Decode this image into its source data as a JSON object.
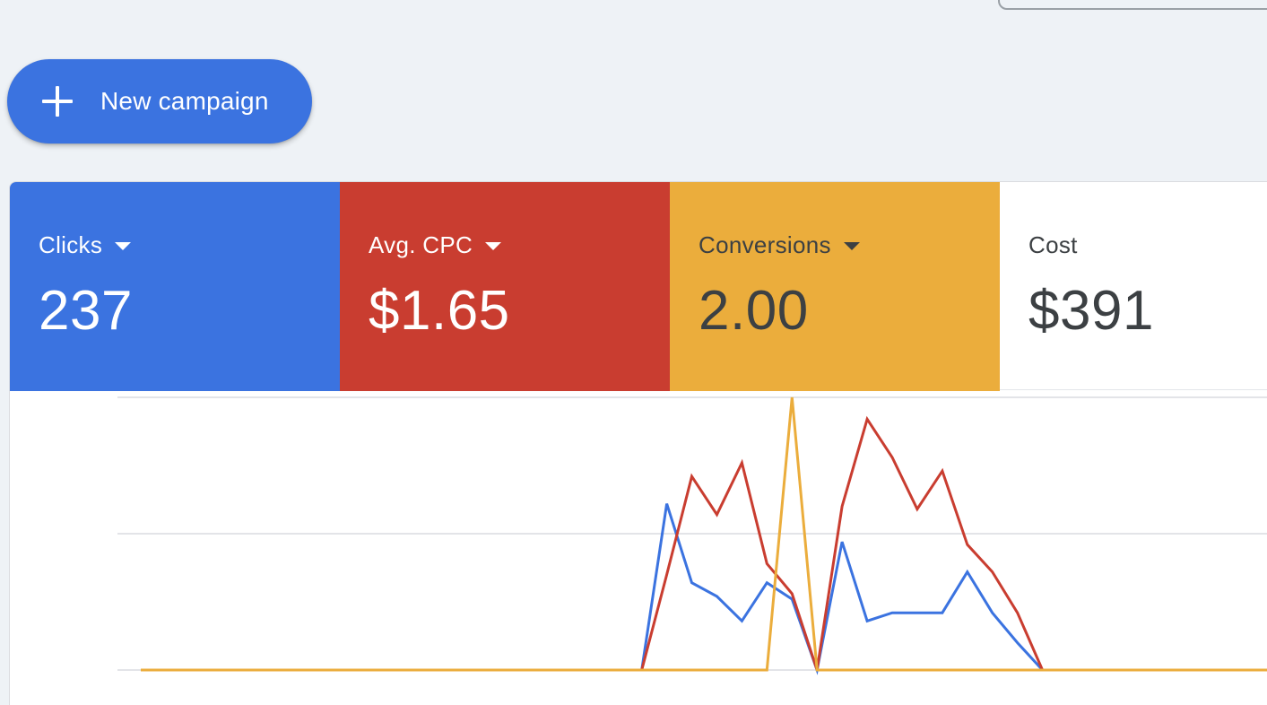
{
  "toolbar": {
    "new_campaign_label": "New campaign"
  },
  "scorecards": [
    {
      "label": "Clicks",
      "value": "237",
      "dropdown": true,
      "color": "#3b73e0"
    },
    {
      "label": "Avg. CPC",
      "value": "$1.65",
      "dropdown": true,
      "color": "#c93d30"
    },
    {
      "label": "Conversions",
      "value": "2.00",
      "dropdown": true,
      "color": "#ebad3c"
    },
    {
      "label": "Cost",
      "value": "$391",
      "dropdown": false,
      "color": "#ffffff"
    }
  ],
  "icons": {
    "new_campaign": "plus-icon",
    "dropdown": "caret-down-icon"
  },
  "chart_data": {
    "type": "line",
    "grid": true,
    "ylim": [
      0,
      1
    ],
    "x": [
      0,
      1,
      2,
      3,
      4,
      5,
      6,
      7,
      8,
      9,
      10,
      11,
      12,
      13,
      14,
      15,
      16,
      17,
      18,
      19,
      20,
      21,
      22,
      23,
      24,
      25,
      26,
      27,
      28,
      29,
      30,
      31,
      32,
      33,
      34,
      35,
      36,
      37,
      38,
      39,
      40,
      41,
      42,
      43,
      44,
      45
    ],
    "series": [
      {
        "color": "#3b73e0",
        "values": [
          0,
          0,
          0,
          0,
          0,
          0,
          0,
          0,
          0,
          0,
          0,
          0,
          0,
          0,
          0,
          0,
          0,
          0,
          0,
          0,
          0,
          0.61,
          0.32,
          0.27,
          0.18,
          0.32,
          0.26,
          0,
          0.47,
          0.18,
          0.21,
          0.21,
          0.21,
          0.36,
          0.21,
          0.1,
          0,
          0,
          0,
          0,
          0,
          0,
          0,
          0,
          0,
          0
        ]
      },
      {
        "color": "#c93d30",
        "values": [
          0,
          0,
          0,
          0,
          0,
          0,
          0,
          0,
          0,
          0,
          0,
          0,
          0,
          0,
          0,
          0,
          0,
          0,
          0,
          0,
          0,
          0.35,
          0.71,
          0.57,
          0.76,
          0.39,
          0.28,
          0,
          0.6,
          0.92,
          0.78,
          0.59,
          0.73,
          0.46,
          0.36,
          0.21,
          0,
          0,
          0,
          0,
          0,
          0,
          0,
          0,
          0,
          0
        ]
      },
      {
        "color": "#ebad3c",
        "values": [
          0,
          0,
          0,
          0,
          0,
          0,
          0,
          0,
          0,
          0,
          0,
          0,
          0,
          0,
          0,
          0,
          0,
          0,
          0,
          0,
          0,
          0,
          0,
          0,
          0,
          0,
          1.0,
          0,
          0,
          0,
          0,
          0,
          0,
          0,
          0,
          0,
          0,
          0,
          0,
          0,
          0,
          0,
          0,
          0,
          0,
          0
        ]
      }
    ]
  }
}
